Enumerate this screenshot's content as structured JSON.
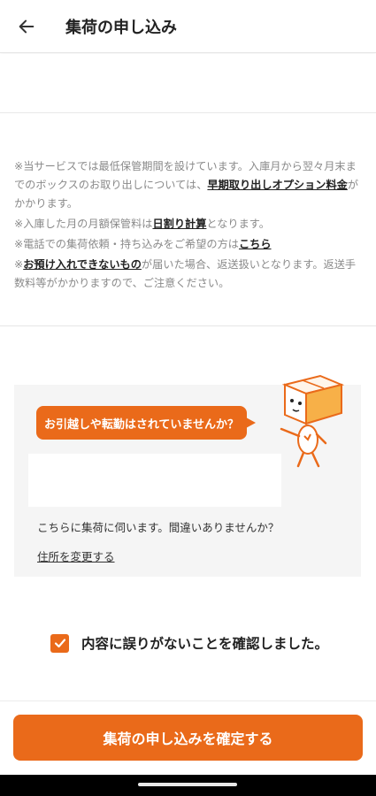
{
  "header": {
    "title": "集荷の申し込み",
    "back_icon": "arrow-left-icon"
  },
  "notes": {
    "line1_text": "※当サービスでは最低保管期間を設けています。入庫月から翌々月末までのボックスのお取り出しについては、",
    "line1_link": "早期取り出しオプション料金",
    "line1_suffix": "がかかります。",
    "line2_text": "※入庫した月の月額保管料は",
    "line2_link": "日割り計算",
    "line2_suffix": "となります。",
    "line3_text": "※電話での集荷依頼・持ち込みをご希望の方は",
    "line3_link": "こちら",
    "line4_prefix": "※",
    "line4_link": "お預け入れできないもの",
    "line4_suffix": "が届いた場合、返送扱いとなります。返送手数料等がかかりますので、ご注意ください。"
  },
  "address_panel": {
    "bubble_text": "お引越しや転勤はされていませんか？",
    "question": "こちらに集荷に伺います。間違いありませんか？",
    "change_link": "住所を変更する",
    "mascot": "box-character-mascot"
  },
  "confirm": {
    "checkbox_label": "内容に誤りがないことを確認しました。",
    "checked": true
  },
  "submit": {
    "label": "集荷の申し込みを確定する"
  },
  "colors": {
    "accent": "#ea6a1a",
    "panel_bg": "#f5f5f5",
    "note_text": "#8a8a8a"
  }
}
